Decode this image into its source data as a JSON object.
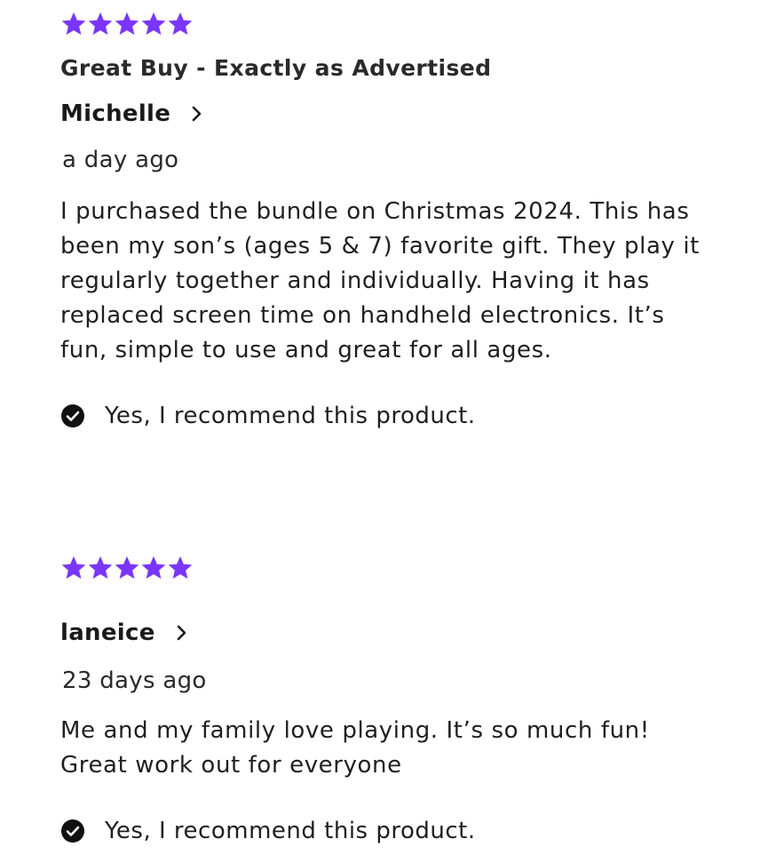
{
  "colors": {
    "star": "#7a35ff",
    "text": "#1f1f1f",
    "check_bg": "#111111"
  },
  "reviews": [
    {
      "rating": 5,
      "title": "Great Buy - Exactly as Advertised",
      "author": "Michelle",
      "date": "a day ago",
      "body": "I purchased the bundle on Christmas 2024. This has been my son’s (ages 5 & 7) favorite gift. They play it regularly together and individually. Having it has replaced screen time on handheld electronics. It’s fun, simple to use and great for all ages.",
      "recommend": "Yes, I recommend this product."
    },
    {
      "rating": 5,
      "title": "",
      "author": "laneice",
      "date": "23 days ago",
      "body": "Me and my family love playing. It’s so much fun! Great work out for everyone",
      "recommend": "Yes, I recommend this product."
    }
  ]
}
